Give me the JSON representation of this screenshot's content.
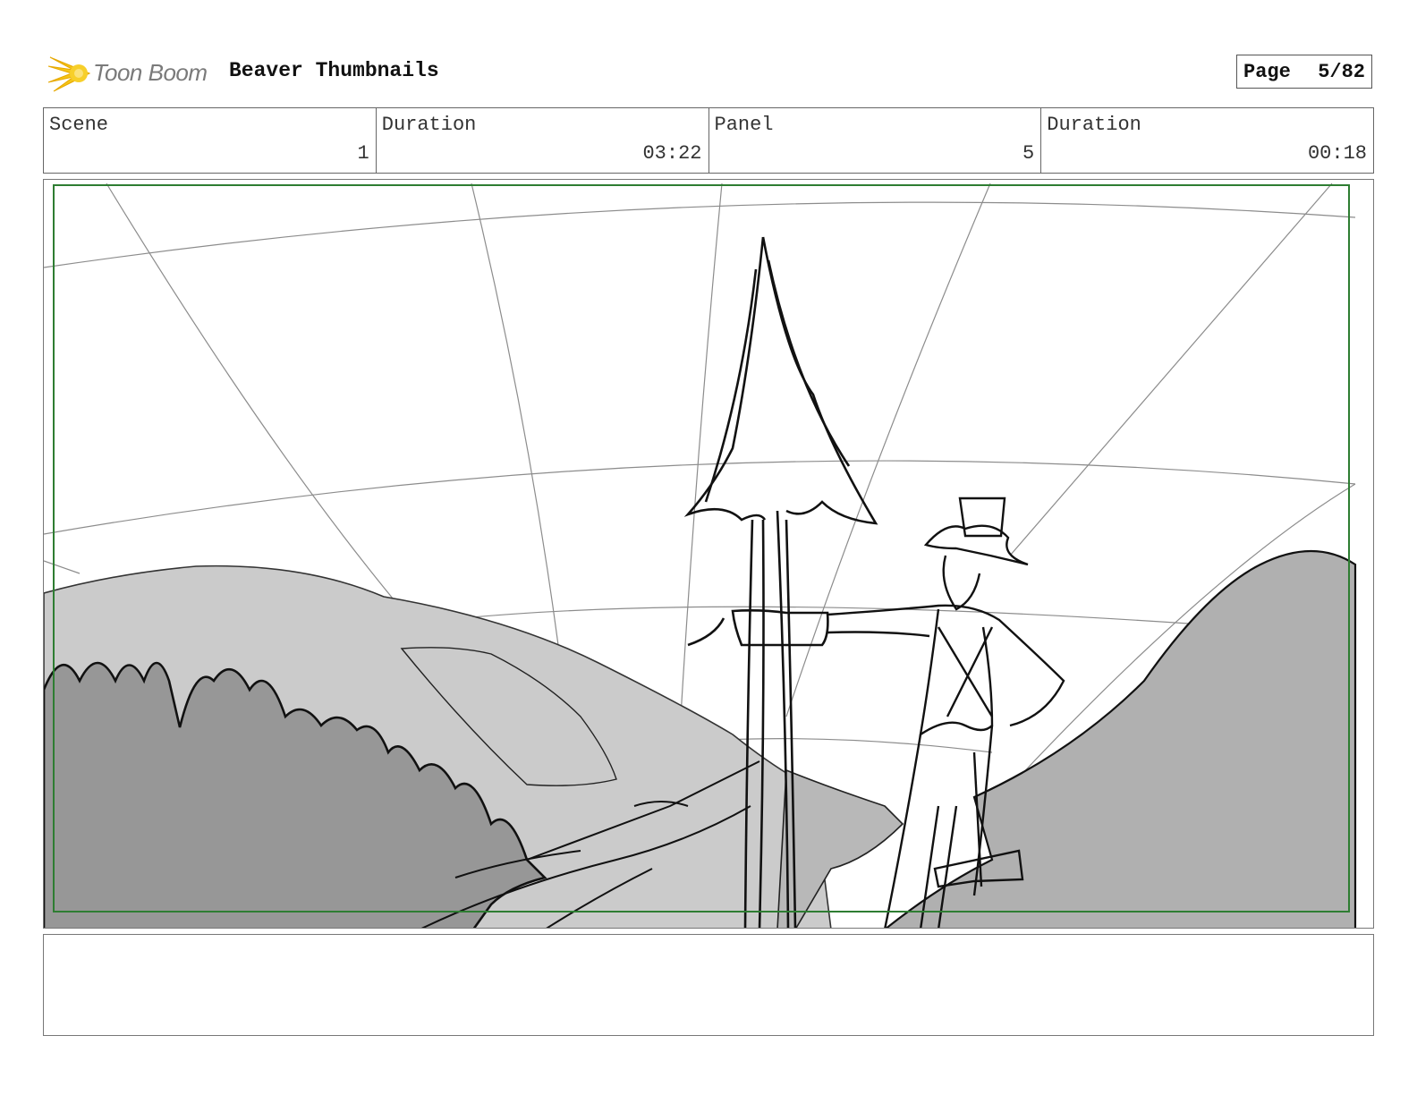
{
  "header": {
    "logo_text": "Toon Boom",
    "project_title": "Beaver Thumbnails",
    "page_label": "Page",
    "page_value": "5/82"
  },
  "info": {
    "scene_label": "Scene",
    "scene_value": "1",
    "scene_duration_label": "Duration",
    "scene_duration_value": "03:22",
    "panel_label": "Panel",
    "panel_value": "5",
    "panel_duration_label": "Duration",
    "panel_duration_value": "00:18"
  },
  "colors": {
    "safe_area": "#2e7d32",
    "hill_light": "#cbcbcb",
    "hill_mid": "#b0b0b0",
    "hill_dark": "#979797",
    "brand_star": "#f5c518"
  },
  "notes": {
    "text": ""
  }
}
